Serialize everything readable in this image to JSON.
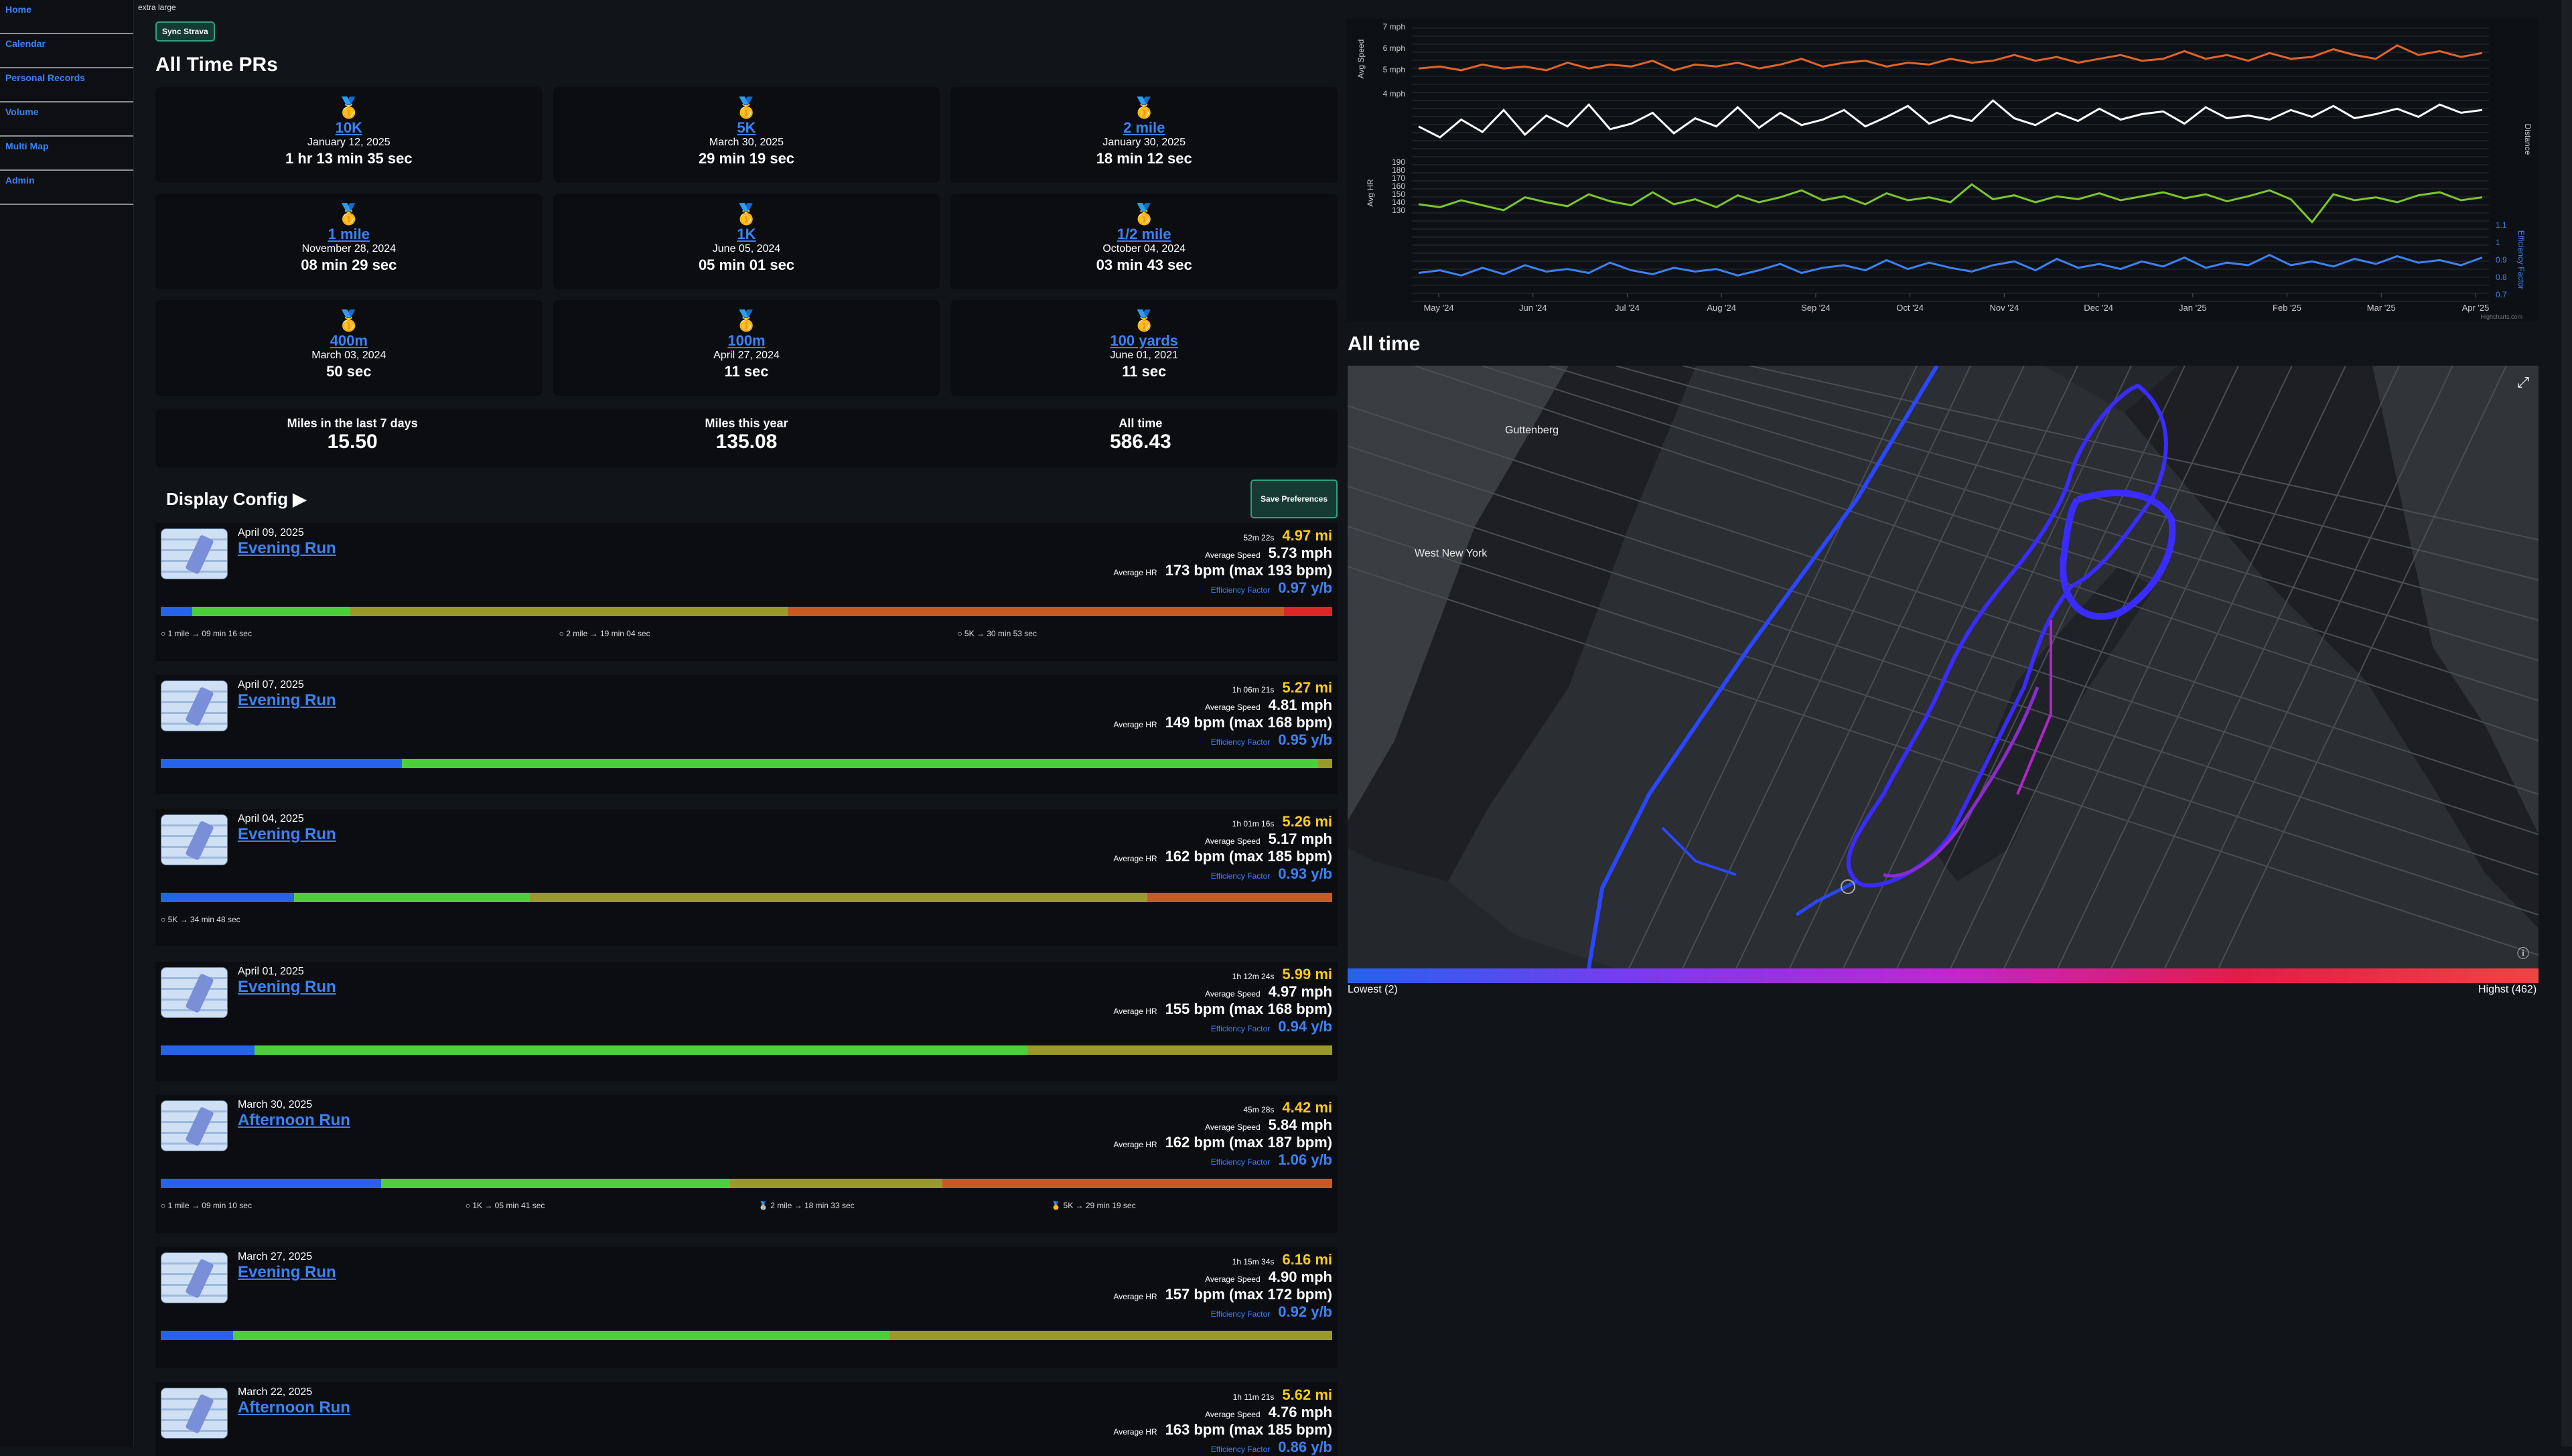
{
  "nav": [
    "Home",
    "Calendar",
    "Personal Records",
    "Volume",
    "Multi Map",
    "Admin"
  ],
  "size_label": "extra large",
  "sync_label": "Sync Strava",
  "prs_title": "All Time PRs",
  "prs": [
    {
      "name": "10K",
      "date": "January 12, 2025",
      "time": "1 hr 13 min 35 sec",
      "medal": "🥇"
    },
    {
      "name": "5K",
      "date": "March 30, 2025",
      "time": "29 min 19 sec",
      "medal": "🥇"
    },
    {
      "name": "2 mile",
      "date": "January 30, 2025",
      "time": "18 min 12 sec",
      "medal": "🥇"
    },
    {
      "name": "1 mile",
      "date": "November 28, 2024",
      "time": "08 min 29 sec",
      "medal": "🥇"
    },
    {
      "name": "1K",
      "date": "June 05, 2024",
      "time": "05 min 01 sec",
      "medal": "🥇"
    },
    {
      "name": "1/2 mile",
      "date": "October 04, 2024",
      "time": "03 min 43 sec",
      "medal": "🥇"
    },
    {
      "name": "400m",
      "date": "March 03, 2024",
      "time": "50 sec",
      "medal": "🥇"
    },
    {
      "name": "100m",
      "date": "April 27, 2024",
      "time": "11 sec",
      "medal": "🥇"
    },
    {
      "name": "100 yards",
      "date": "June 01, 2021",
      "time": "11 sec",
      "medal": "🥇"
    }
  ],
  "stats": [
    {
      "label": "Miles in the last 7 days",
      "value": "15.50"
    },
    {
      "label": "Miles this year",
      "value": "135.08"
    },
    {
      "label": "All time",
      "value": "586.43"
    }
  ],
  "display_config": "Display Config ▶",
  "save_prefs": "Save Preferences",
  "labels": {
    "avg_speed": "Average Speed",
    "avg_hr": "Average HR",
    "eff": "Efficiency Factor"
  },
  "zone_colors": [
    "#2563eb",
    "#4cd03a",
    "#9a9a2a",
    "#c75a1f",
    "#dc2626"
  ],
  "activities": [
    {
      "date": "April 09, 2025",
      "name": "Evening Run",
      "duration": "52m 22s",
      "distance": "4.97 mi",
      "speed": "5.73 mph",
      "hr": "173 bpm (max 193 bpm)",
      "ef": "0.97 y/b",
      "zones": [
        2.7,
        13.5,
        37.3,
        42.4,
        4.1
      ],
      "splits": [
        {
          "pos": 0,
          "text": "1 mile → 09 min 16 sec",
          "medal": "○"
        },
        {
          "pos": 34,
          "text": "2 mile → 19 min 04 sec",
          "medal": "○"
        },
        {
          "pos": 68,
          "text": "5K → 30 min 53 sec",
          "medal": "○"
        }
      ]
    },
    {
      "date": "April 07, 2025",
      "name": "Evening Run",
      "duration": "1h 06m 21s",
      "distance": "5.27 mi",
      "speed": "4.81 mph",
      "hr": "149 bpm (max 168 bpm)",
      "ef": "0.95 y/b",
      "zones": [
        20.6,
        78.2,
        1.2,
        0,
        0
      ],
      "splits": []
    },
    {
      "date": "April 04, 2025",
      "name": "Evening Run",
      "duration": "1h 01m 16s",
      "distance": "5.26 mi",
      "speed": "5.17 mph",
      "hr": "162 bpm (max 185 bpm)",
      "ef": "0.93 y/b",
      "zones": [
        11.4,
        20.1,
        52.7,
        15.8,
        0
      ],
      "splits": [
        {
          "pos": 0,
          "text": "5K → 34 min 48 sec",
          "medal": "○"
        }
      ]
    },
    {
      "date": "April 01, 2025",
      "name": "Evening Run",
      "duration": "1h 12m 24s",
      "distance": "5.99 mi",
      "speed": "4.97 mph",
      "hr": "155 bpm (max 168 bpm)",
      "ef": "0.94 y/b",
      "zones": [
        8,
        66,
        26,
        0,
        0
      ],
      "splits": []
    },
    {
      "date": "March 30, 2025",
      "name": "Afternoon Run",
      "duration": "45m 28s",
      "distance": "4.42 mi",
      "speed": "5.84 mph",
      "hr": "162 bpm (max 187 bpm)",
      "ef": "1.06 y/b",
      "zones": [
        18.8,
        29.8,
        18.1,
        33.3,
        0
      ],
      "splits": [
        {
          "pos": 0,
          "text": "1 mile → 09 min 10 sec",
          "medal": "○"
        },
        {
          "pos": 26,
          "text": "1K → 05 min 41 sec",
          "medal": "○"
        },
        {
          "pos": 51,
          "text": "2 mile → 18 min 33 sec",
          "medal": "🥈"
        },
        {
          "pos": 76,
          "text": "5K → 29 min 19 sec",
          "medal": "🥇"
        }
      ]
    },
    {
      "date": "March 27, 2025",
      "name": "Evening Run",
      "duration": "1h 15m 34s",
      "distance": "6.16 mi",
      "speed": "4.90 mph",
      "hr": "157 bpm (max 172 bpm)",
      "ef": "0.92 y/b",
      "zones": [
        6.2,
        56,
        37.8,
        0,
        0
      ],
      "splits": []
    },
    {
      "date": "March 22, 2025",
      "name": "Afternoon Run",
      "duration": "1h 11m 21s",
      "distance": "5.62 mi",
      "speed": "4.76 mph",
      "hr": "163 bpm (max 185 bpm)",
      "ef": "0.86 y/b",
      "zones": [],
      "splits": []
    }
  ],
  "chart_data": {
    "type": "line",
    "x_labels": [
      "May '24",
      "Jun '24",
      "Jul '24",
      "Aug '24",
      "Sep '24",
      "Oct '24",
      "Nov '24",
      "Dec '24",
      "Jan '25",
      "Feb '25",
      "Mar '25",
      "Apr '25"
    ],
    "speed_ticks": [
      "7 mph",
      "6 mph",
      "5 mph",
      "4 mph"
    ],
    "hr_ticks": [
      "190",
      "180",
      "170",
      "160",
      "150",
      "140",
      "130"
    ],
    "ef_ticks": [
      "1.1",
      "1",
      "0.9",
      "0.8",
      "0.7"
    ],
    "y_title_speed": "Avg Speed",
    "y_title_hr": "Avg HR",
    "y_title_dist": "Distance",
    "y_title_ef": "Efficiency Factor",
    "credit": "Highcharts.com",
    "series": [
      {
        "name": "Avg Speed",
        "color": "#e0642a",
        "values": [
          5.1,
          5.2,
          5.0,
          5.3,
          5.1,
          5.2,
          5.0,
          5.4,
          5.1,
          5.3,
          5.2,
          5.5,
          5.0,
          5.3,
          5.2,
          5.4,
          5.1,
          5.3,
          5.6,
          5.2,
          5.4,
          5.5,
          5.2,
          5.4,
          5.3,
          5.6,
          5.4,
          5.5,
          5.8,
          5.5,
          5.7,
          5.4,
          5.6,
          5.8,
          5.5,
          5.6,
          6.0,
          5.6,
          5.8,
          5.5,
          5.9,
          5.6,
          5.7,
          6.1,
          5.8,
          5.6,
          6.3,
          5.8,
          6.0,
          5.7,
          5.9
        ]
      },
      {
        "name": "Distance",
        "color": "#ffffff",
        "values": [
          3.0,
          2.2,
          3.5,
          2.6,
          4.2,
          2.4,
          3.8,
          3.0,
          4.6,
          2.8,
          3.2,
          4.0,
          2.5,
          3.6,
          3.0,
          4.4,
          2.9,
          4.0,
          3.1,
          3.5,
          4.2,
          3.0,
          3.7,
          4.5,
          3.2,
          3.8,
          3.4,
          4.9,
          3.6,
          3.1,
          4.0,
          3.4,
          4.3,
          3.5,
          3.9,
          4.1,
          3.2,
          4.4,
          3.6,
          3.8,
          3.5,
          4.2,
          3.7,
          4.5,
          3.6,
          3.9,
          4.3,
          3.7,
          4.6,
          4.0,
          4.2
        ]
      },
      {
        "name": "Avg HR",
        "color": "#7bc62d",
        "values": [
          158,
          155,
          162,
          157,
          152,
          165,
          160,
          156,
          168,
          161,
          157,
          170,
          158,
          163,
          155,
          167,
          160,
          165,
          172,
          162,
          166,
          158,
          169,
          162,
          165,
          160,
          178,
          163,
          167,
          160,
          166,
          163,
          169,
          162,
          166,
          170,
          164,
          168,
          161,
          166,
          172,
          163,
          140,
          168,
          162,
          165,
          160,
          167,
          170,
          162,
          165
        ]
      },
      {
        "name": "Efficiency Factor",
        "color": "#3b82f6",
        "values": [
          0.84,
          0.86,
          0.82,
          0.88,
          0.83,
          0.9,
          0.85,
          0.87,
          0.84,
          0.92,
          0.86,
          0.83,
          0.88,
          0.85,
          0.87,
          0.82,
          0.86,
          0.91,
          0.84,
          0.88,
          0.9,
          0.86,
          0.94,
          0.87,
          0.92,
          0.88,
          0.85,
          0.9,
          0.93,
          0.86,
          0.95,
          0.88,
          0.91,
          0.87,
          0.93,
          0.89,
          0.96,
          0.88,
          0.92,
          0.9,
          0.98,
          0.9,
          0.93,
          0.89,
          0.95,
          0.91,
          0.97,
          0.92,
          0.94,
          0.9,
          0.96
        ]
      }
    ]
  },
  "alltime_title": "All time",
  "map_labels": [
    "Guttenberg",
    "West New York"
  ],
  "legend_low": "Lowest (2)",
  "legend_high": "Highst (462)"
}
